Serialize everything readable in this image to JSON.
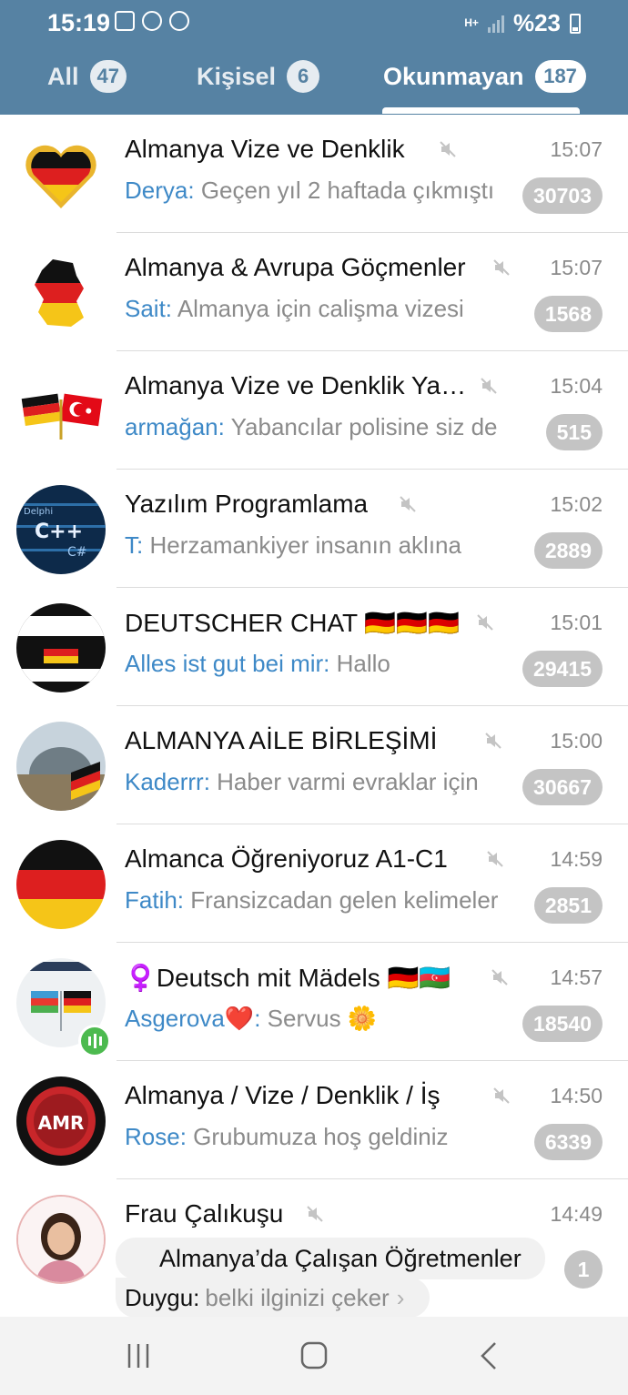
{
  "status_bar": {
    "time": "15:19",
    "network": "H+",
    "battery": "%23"
  },
  "tabs": [
    {
      "label": "All",
      "badge": "47"
    },
    {
      "label": "Kişisel",
      "badge": "6"
    },
    {
      "label": "Okunmayan",
      "badge": "187",
      "active": true
    }
  ],
  "chats": [
    {
      "title": "Almanya Vize ve Denklik",
      "time": "15:07",
      "sender": "Derya:",
      "message": "Geçen yıl 2 haftada çıkmıştı",
      "count": "30703",
      "avatar": "heart-flag-avatar"
    },
    {
      "title": "Almanya & Avrupa Göçmenler",
      "time": "15:07",
      "sender": "Sait:",
      "message": "Almanya için calişma vizesi",
      "count": "1568",
      "avatar": "germany-map-avatar"
    },
    {
      "title": "Almanya Vize ve Denklik Yardım",
      "time": "15:04",
      "sender": "armağan:",
      "message": "Yabancılar polisine siz de",
      "count": "515",
      "avatar": "crossed-flags-avatar"
    },
    {
      "title": "Yazılım Programlama",
      "time": "15:02",
      "sender": "T:",
      "message": "Herzamankiyer insanın aklına",
      "count": "2889",
      "avatar": "code-avatar"
    },
    {
      "title": "DEUTSCHER CHAT 🇩🇪🇩🇪🇩🇪",
      "time": "15:01",
      "sender": "Alles ist gut bei mir:",
      "message": "Hallo",
      "count": "29415",
      "avatar": "deutschland-sign-avatar"
    },
    {
      "title": "ALMANYA AİLE BİRLEŞİMİ",
      "time": "15:00",
      "sender": "Kaderrr:",
      "message": "Haber varmi evraklar için",
      "count": "30667",
      "avatar": "reichstag-avatar"
    },
    {
      "title": "Almanca Öğreniyoruz A1-C1",
      "time": "14:59",
      "sender": "Fatih:",
      "message": "Fransizcadan gelen kelimeler",
      "count": "2851",
      "avatar": "flag-avatar"
    },
    {
      "title": "♀️Deutsch mit Mädels 🇩🇪🇦🇿",
      "time": "14:57",
      "sender": "Asgerova❤️:",
      "message": "Servus 🌼",
      "count": "18540",
      "avatar": "az-de-flags-avatar"
    },
    {
      "title": "Almanya / Vize / Denklik / İş",
      "time": "14:50",
      "sender": "Rose:",
      "message": "Grubumuza hoş geldiniz",
      "count": "6339",
      "avatar": "amr-global-avatar"
    }
  ],
  "last_chat": {
    "title": "Frau Çalıkuşu",
    "time": "14:49",
    "reply": "Almanya’da Çalışan Öğretmenler",
    "sender": "Duygu:",
    "message": "belki ilginizi çeker",
    "count": "1"
  },
  "colors": {
    "header": "#5682a3",
    "sender": "#3e89c7",
    "badge": "#c4c4c4"
  }
}
